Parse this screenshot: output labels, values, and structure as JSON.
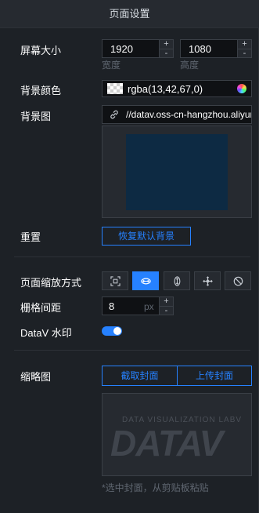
{
  "header": {
    "title": "页面设置"
  },
  "screen_size": {
    "label": "屏幕大小",
    "width_value": "1920",
    "height_value": "1080",
    "width_label": "宽度",
    "height_label": "高度",
    "plus": "+",
    "minus": "-"
  },
  "bg_color": {
    "label": "背景颜色",
    "value": "rgba(13,42,67,0)"
  },
  "bg_image": {
    "label": "背景图",
    "url": "//datav.oss-cn-hangzhou.aliyuncs.com"
  },
  "reset": {
    "label": "重置",
    "button": "恢复默认背景"
  },
  "scale_mode": {
    "label": "页面缩放方式",
    "options": [
      "fit-all-icon",
      "fit-width-icon",
      "fit-height-icon",
      "full-screen-icon",
      "no-scale-icon"
    ],
    "active_index": 1
  },
  "grid": {
    "label": "栅格间距",
    "value": "8",
    "unit": "px",
    "plus": "+",
    "minus": "-"
  },
  "watermark": {
    "label": "DataV 水印",
    "enabled": true
  },
  "thumbnail": {
    "label": "缩略图",
    "capture_button": "截取封面",
    "upload_button": "上传封面",
    "watermark_small": "DATA VISUALIZATION LABV",
    "watermark_big": "DATAV",
    "hint": "*选中封面，从剪贴板粘贴"
  },
  "colors": {
    "accent": "#2681ff",
    "panel_bg": "#1d2126",
    "input_bg": "#0f1114",
    "preview_fill": "#0d2a43"
  }
}
